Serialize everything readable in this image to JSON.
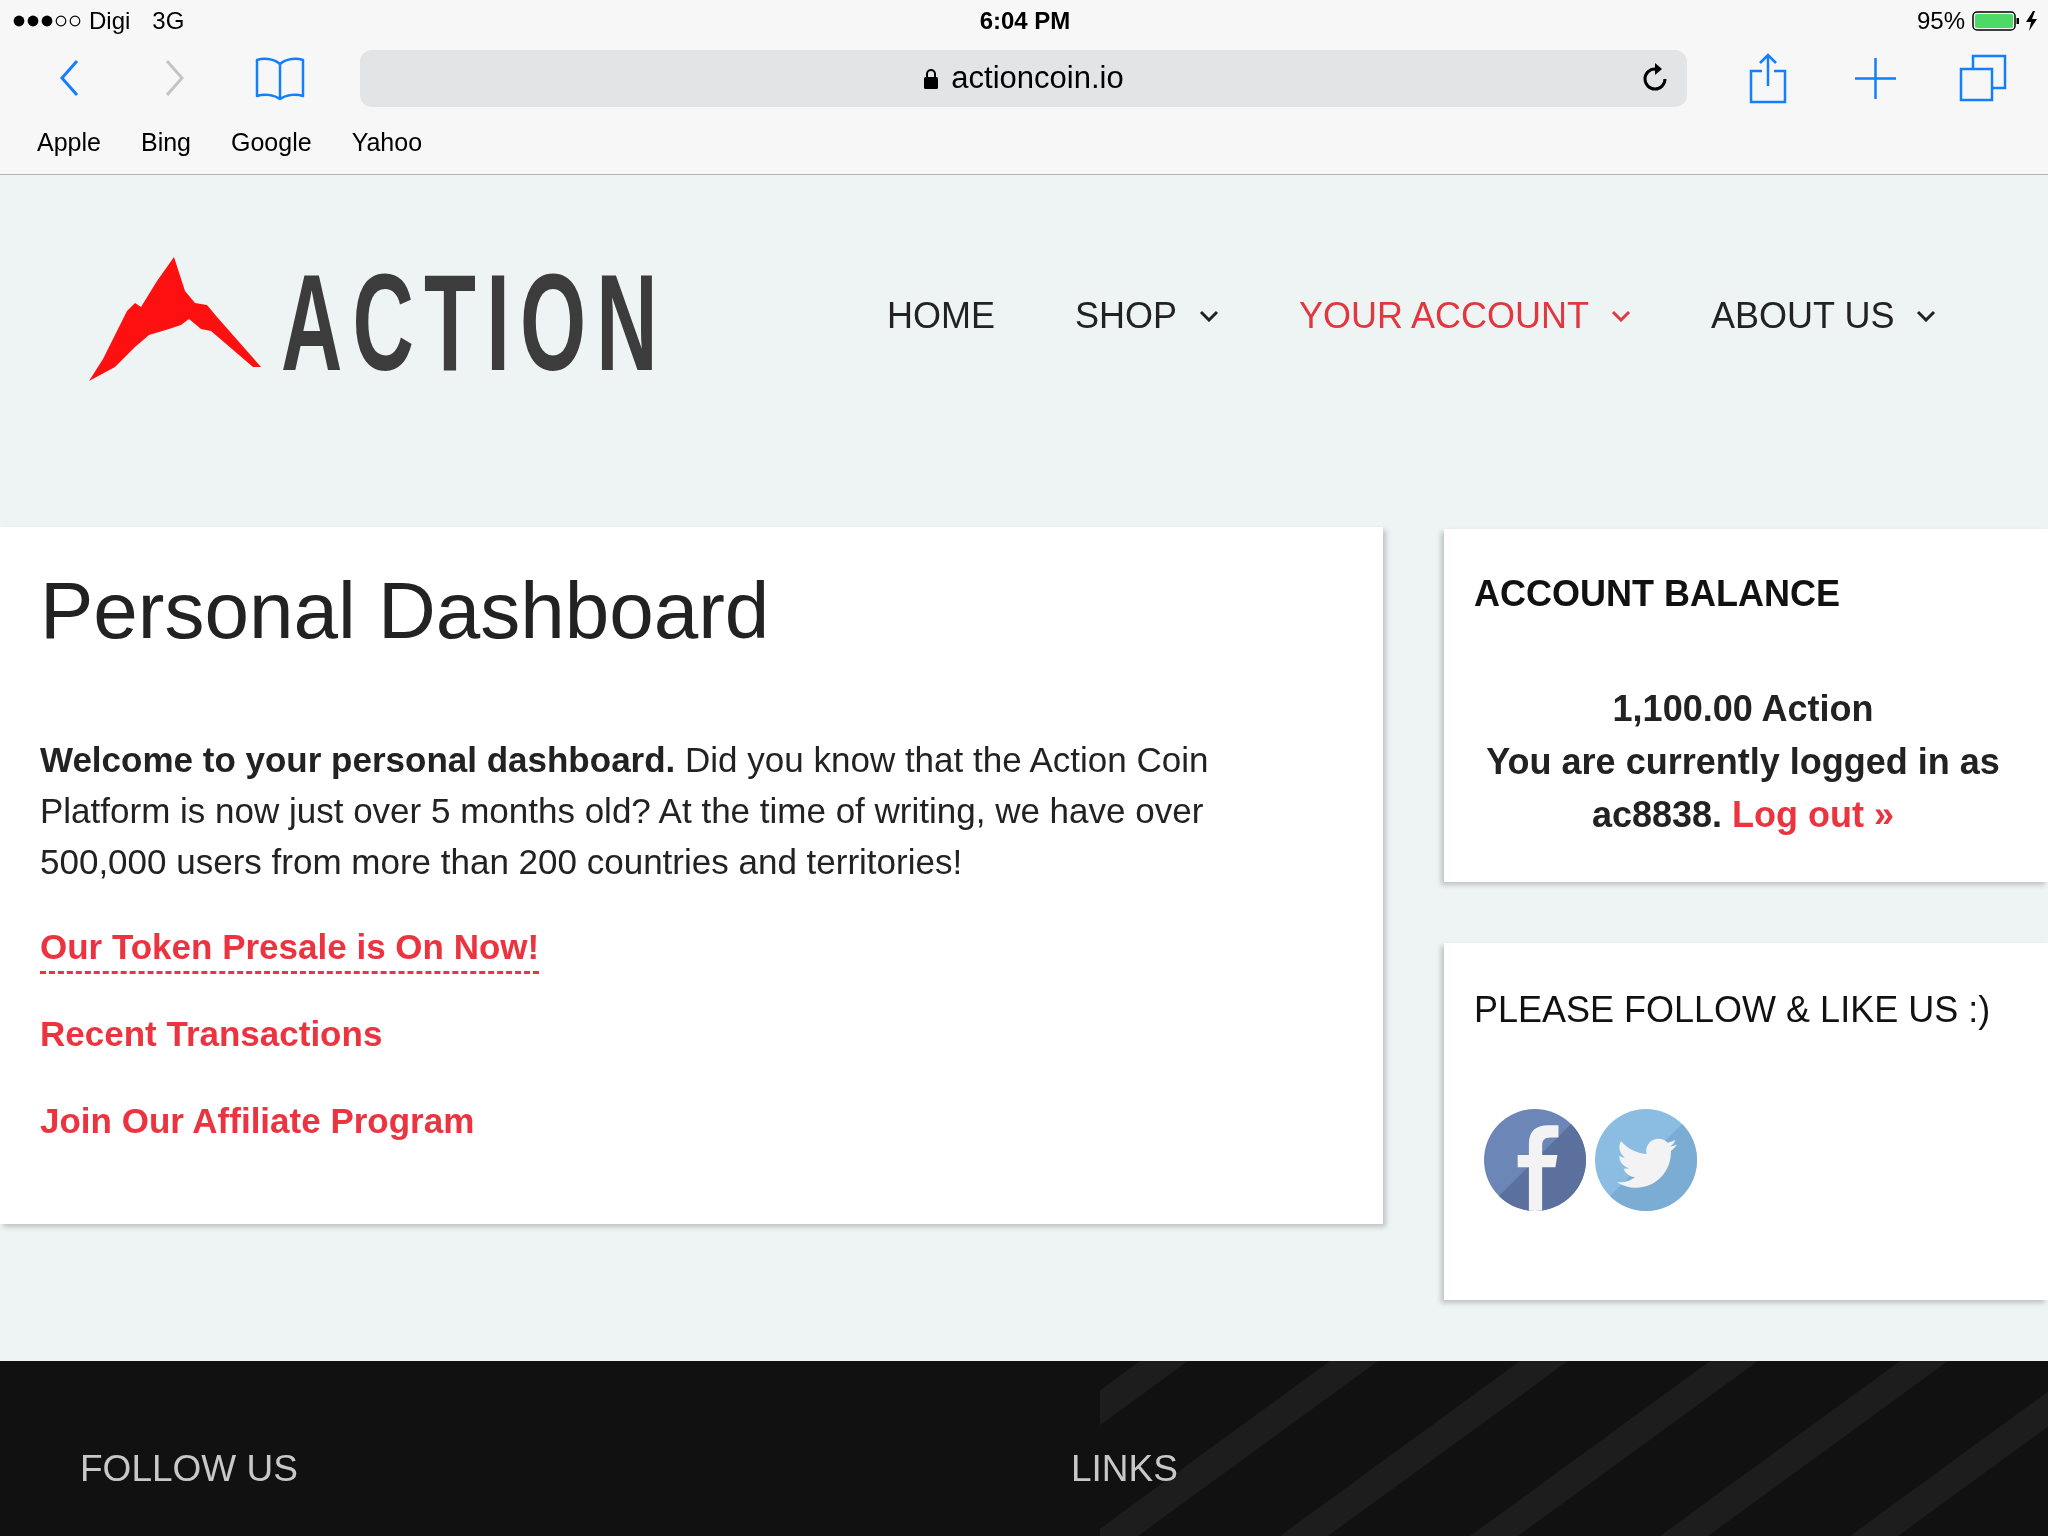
{
  "status_bar": {
    "carrier": "Digi",
    "network": "3G",
    "time": "6:04 PM",
    "battery": "95%"
  },
  "browser": {
    "nav_buttons": [
      {
        "kind": "back",
        "disabled": false
      },
      {
        "kind": "forward",
        "disabled": true
      }
    ],
    "address": "actioncoin.io",
    "favorites": [
      "Apple",
      "Bing",
      "Google",
      "Yahoo"
    ]
  },
  "header": {
    "logo": "ACTION",
    "nav": [
      {
        "label": "HOME",
        "selected": false,
        "dropdown": false
      },
      {
        "label": "SHOP",
        "selected": false,
        "dropdown": true
      },
      {
        "label": "YOUR ACCOUNT",
        "selected": true,
        "dropdown": true
      },
      {
        "label": "ABOUT US",
        "selected": false,
        "dropdown": true
      }
    ]
  },
  "dashboard": {
    "title": "Personal Dashboard",
    "intro": "**Welcome to your personal dashboard.** Did you know that the Action Coin Platform is now just over 5 months old? At the time of writing, we have over 500,000 users from more than 200 countries and territories!",
    "links": [
      {
        "label": "Our Token Presale is On Now!",
        "dashed_underline": true
      },
      {
        "label": "Recent Transactions",
        "dashed_underline": false
      },
      {
        "label": "Join Our Affiliate Program",
        "dashed_underline": false
      }
    ]
  },
  "account_balance": {
    "title": "ACCOUNT BALANCE",
    "balance": "1,100.00 Action",
    "login_status": "You are currently logged in as ac8838.",
    "logout_link": "Log out »"
  },
  "social": {
    "title": "PLEASE FOLLOW & LIKE US :)"
  },
  "footer": {
    "headings": [
      "FOLLOW US",
      "LINKS"
    ]
  }
}
